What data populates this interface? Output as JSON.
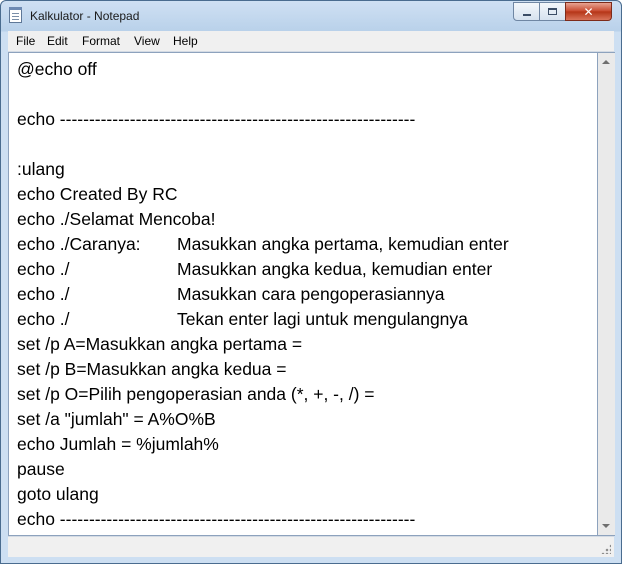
{
  "window": {
    "title": "Kalkulator - Notepad",
    "minimize_glyph": "",
    "maximize_glyph": "",
    "close_glyph": "✕"
  },
  "menubar": {
    "items": [
      "File",
      "Edit",
      "Format",
      "View",
      "Help"
    ]
  },
  "editor": {
    "lines": [
      [
        "@echo off",
        ""
      ],
      [
        "",
        ""
      ],
      [
        "echo -------------------------------------------------------------",
        ""
      ],
      [
        "",
        ""
      ],
      [
        ":ulang",
        ""
      ],
      [
        "echo Created By RC",
        ""
      ],
      [
        "echo ./Selamat Mencoba!",
        ""
      ],
      [
        "echo ./Caranya:",
        "Masukkan angka pertama, kemudian enter"
      ],
      [
        "echo ./",
        "Masukkan angka kedua, kemudian enter"
      ],
      [
        "echo ./",
        "Masukkan cara pengoperasiannya"
      ],
      [
        "echo ./",
        "Tekan enter lagi untuk mengulangnya"
      ],
      [
        "set /p A=Masukkan angka pertama =",
        ""
      ],
      [
        "set /p B=Masukkan angka kedua =",
        ""
      ],
      [
        "set /p O=Pilih pengoperasian anda (*, +, -, /) =",
        ""
      ],
      [
        "set /a \"jumlah\" = A%O%B",
        ""
      ],
      [
        "echo Jumlah = %jumlah%",
        ""
      ],
      [
        "pause",
        ""
      ],
      [
        "goto ulang",
        ""
      ],
      [
        "echo -------------------------------------------------------------",
        ""
      ]
    ]
  }
}
